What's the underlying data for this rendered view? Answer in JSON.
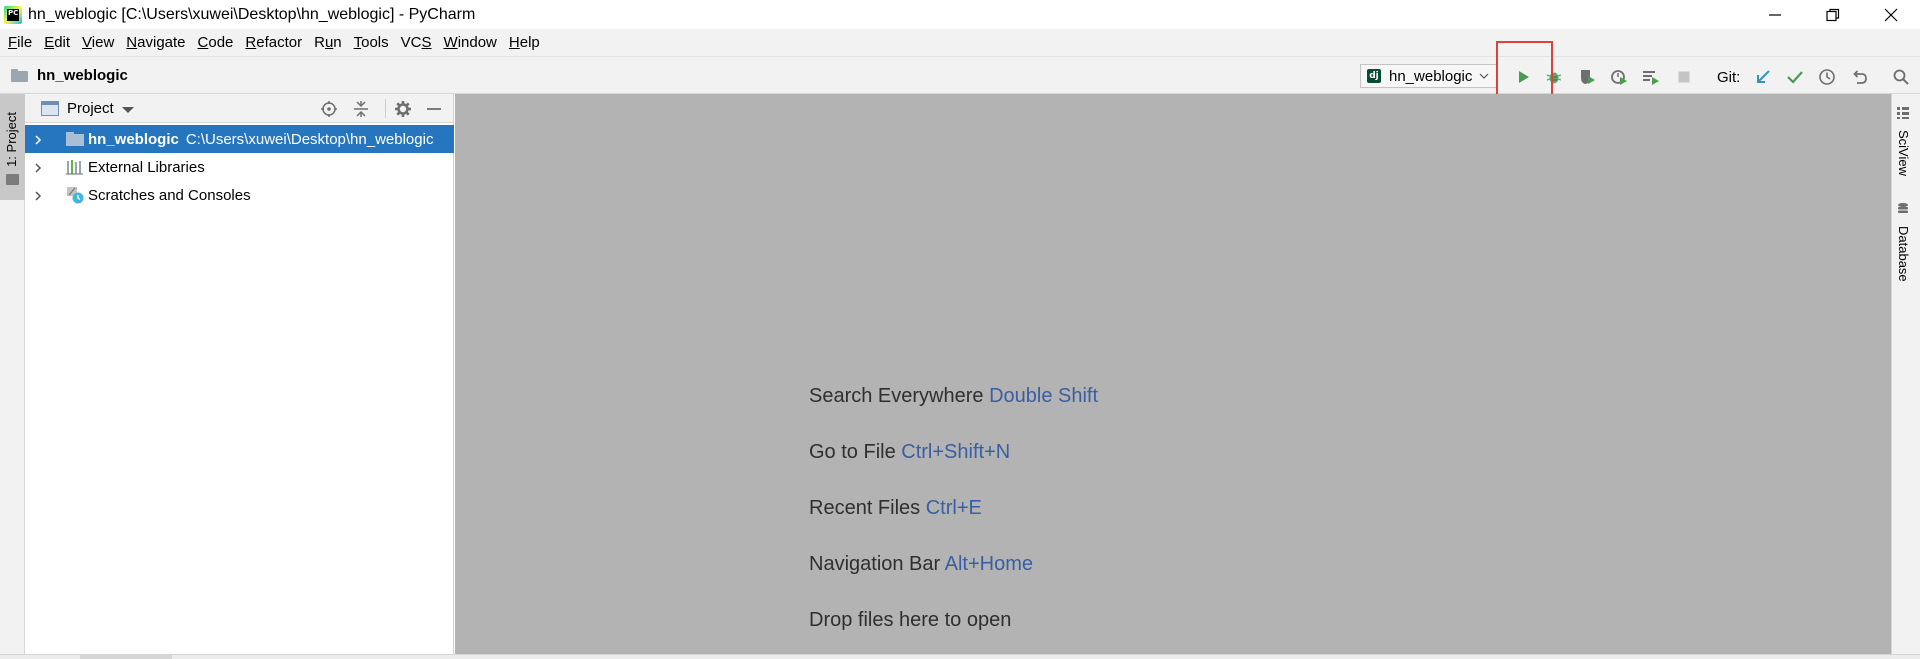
{
  "window": {
    "title": "hn_weblogic [C:\\Users\\xuwei\\Desktop\\hn_weblogic] - PyCharm",
    "app_icon": "PC"
  },
  "menu": [
    {
      "label": "File",
      "mnemonic": "F"
    },
    {
      "label": "Edit",
      "mnemonic": "E"
    },
    {
      "label": "View",
      "mnemonic": "V"
    },
    {
      "label": "Navigate",
      "mnemonic": "N"
    },
    {
      "label": "Code",
      "mnemonic": "C"
    },
    {
      "label": "Refactor",
      "mnemonic": "R"
    },
    {
      "label": "Run",
      "mnemonic": "u"
    },
    {
      "label": "Tools",
      "mnemonic": "T"
    },
    {
      "label": "VCS",
      "mnemonic": "S"
    },
    {
      "label": "Window",
      "mnemonic": "W"
    },
    {
      "label": "Help",
      "mnemonic": "H"
    }
  ],
  "navbar": {
    "breadcrumb": "hn_weblogic",
    "run_config": {
      "icon_text": "dj",
      "label": "hn_weblogic"
    },
    "git_label": "Git:"
  },
  "left_strip": {
    "project_tab": "1: Project"
  },
  "project_panel": {
    "title": "Project",
    "tree": [
      {
        "name": "hn_weblogic",
        "path": "C:\\Users\\xuwei\\Desktop\\hn_weblogic",
        "selected": true
      },
      {
        "name": "External Libraries",
        "path": ""
      },
      {
        "name": "Scratches and Consoles",
        "path": ""
      }
    ]
  },
  "editor": {
    "hints": [
      {
        "text": "Search Everywhere",
        "key": "Double Shift"
      },
      {
        "text": "Go to File",
        "key": "Ctrl+Shift+N"
      },
      {
        "text": "Recent Files",
        "key": "Ctrl+E"
      },
      {
        "text": "Navigation Bar",
        "key": "Alt+Home"
      },
      {
        "text": "Drop files here to open",
        "key": ""
      }
    ]
  },
  "right_strip": {
    "tabs": [
      "SciView",
      "Database"
    ]
  },
  "colors": {
    "selection": "#2675bf",
    "editor_bg": "#b3b3b3",
    "shortcut": "#3a5ea6",
    "run_green": "#499c54",
    "highlight_red": "#e0403c"
  }
}
